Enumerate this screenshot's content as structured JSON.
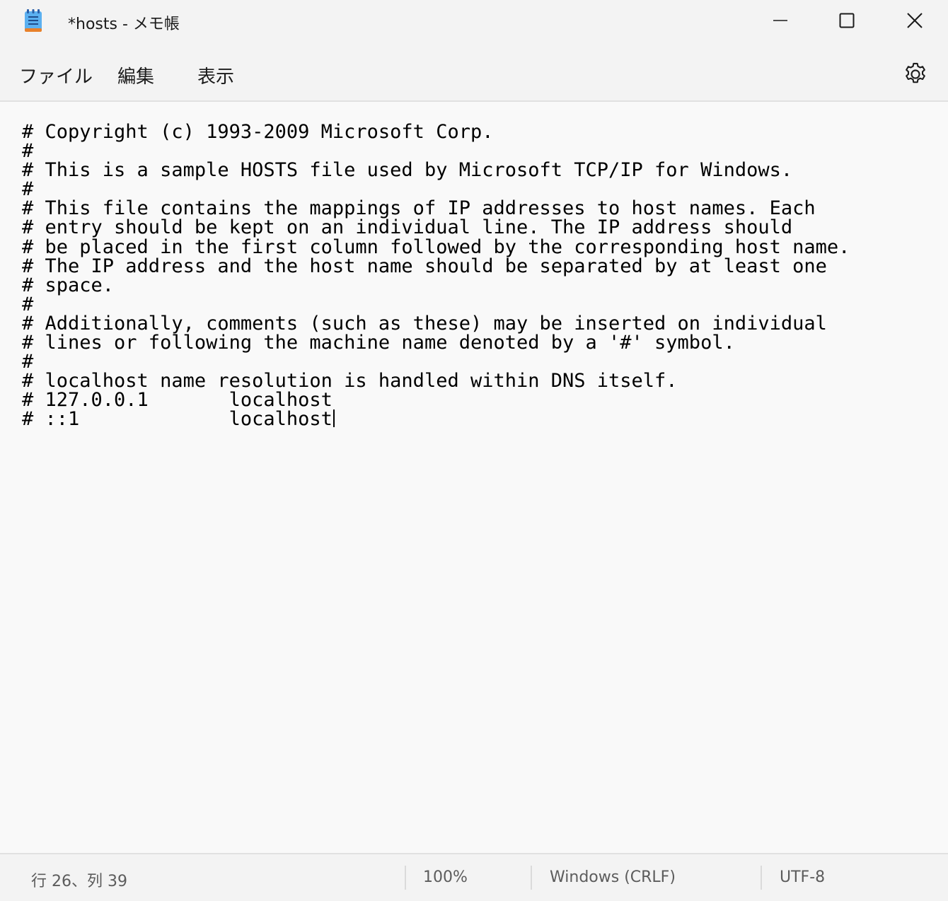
{
  "window": {
    "title": "*hosts - メモ帳",
    "icons": {
      "app": "notepad-icon",
      "minimize": "minimize-icon",
      "maximize": "maximize-icon",
      "close": "close-icon"
    }
  },
  "menubar": {
    "items": [
      {
        "label": "ファイル"
      },
      {
        "label": "編集"
      },
      {
        "label": "表示"
      }
    ],
    "settings_icon": "gear-icon"
  },
  "editor": {
    "content": "# Copyright (c) 1993-2009 Microsoft Corp.\n#\n# This is a sample HOSTS file used by Microsoft TCP/IP for Windows.\n#\n# This file contains the mappings of IP addresses to host names. Each\n# entry should be kept on an individual line. The IP address should\n# be placed in the first column followed by the corresponding host name.\n# The IP address and the host name should be separated by at least one\n# space.\n#\n# Additionally, comments (such as these) may be inserted on individual\n# lines or following the machine name denoted by a '#' symbol.\n#\n# localhost name resolution is handled within DNS itself.\n# 127.0.0.1       localhost\n# ::1             localhost"
  },
  "statusbar": {
    "position": "行 26、列 39",
    "zoom": "100%",
    "line_ending": "Windows (CRLF)",
    "encoding": "UTF-8"
  },
  "colors": {
    "chrome": "#f3f3f3",
    "editor_bg": "#f9f9f9",
    "icon_accent": "#2b7cd3"
  }
}
